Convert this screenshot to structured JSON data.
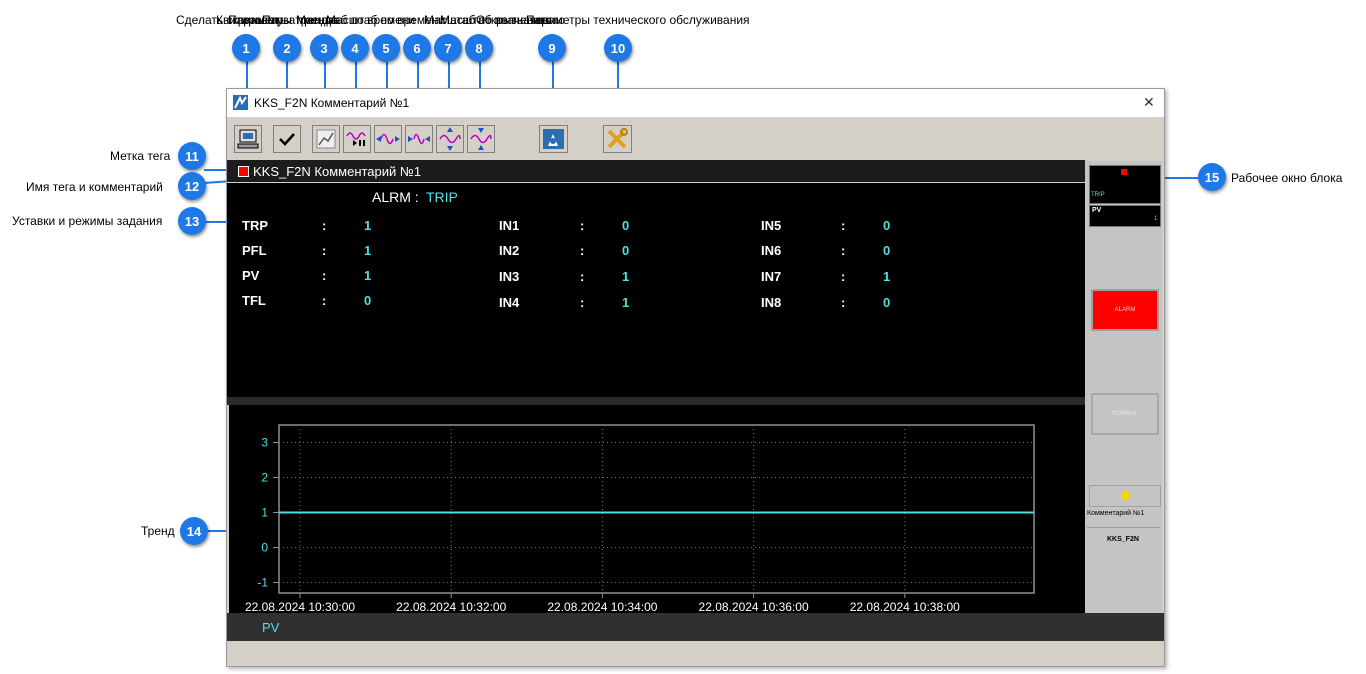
{
  "window": {
    "title": "KKS_F2N Комментарий №1",
    "close_glyph": "✕"
  },
  "toolbar_tooltips": [
    "Сделать скриншот",
    "Квитировать",
    "Параметры тренда",
    "Пауза тренда",
    "Масштаб по времени",
    "Масштаб по времени",
    "Масштаб по значению",
    "Масштаб по значению",
    "Открыть окно",
    "Параметры технического обслуживания"
  ],
  "toolbar_title_visible": "Параметры технического обслуживания",
  "tag": {
    "name": "KKS_F2N Комментарий №1",
    "marker_color": "#ff0000"
  },
  "alarm": {
    "label": "ALRM :",
    "value": "TRIP"
  },
  "params": {
    "col1": [
      {
        "k": "TRP",
        "sep": ":",
        "v": "1"
      },
      {
        "k": "PFL",
        "sep": ":",
        "v": "1"
      },
      {
        "k": "PV",
        "sep": ":",
        "v": "1"
      },
      {
        "k": "TFL",
        "sep": ":",
        "v": "0"
      }
    ],
    "col2": [
      {
        "k": "IN1",
        "sep": ":",
        "v": "0"
      },
      {
        "k": "IN2",
        "sep": ":",
        "v": "0"
      },
      {
        "k": "IN3",
        "sep": ":",
        "v": "1"
      },
      {
        "k": "IN4",
        "sep": ":",
        "v": "1"
      }
    ],
    "col3": [
      {
        "k": "IN5",
        "sep": ":",
        "v": "0"
      },
      {
        "k": "IN6",
        "sep": ":",
        "v": "0"
      },
      {
        "k": "IN7",
        "sep": ":",
        "v": "1"
      },
      {
        "k": "IN8",
        "sep": ":",
        "v": "0"
      }
    ]
  },
  "trend": {
    "y_ticks": [
      "3",
      "2",
      "1",
      "0",
      "-1"
    ],
    "x_ticks": [
      "22.08.2024 10:30:00",
      "22.08.2024 10:32:00",
      "22.08.2024 10:34:00",
      "22.08.2024 10:36:00",
      "22.08.2024 10:38:00"
    ],
    "legend": "PV",
    "line_color": "#4fe0e0"
  },
  "chart_data": {
    "type": "line",
    "x": [
      "22.08.2024 10:30:00",
      "22.08.2024 10:32:00",
      "22.08.2024 10:34:00",
      "22.08.2024 10:36:00",
      "22.08.2024 10:38:00",
      "22.08.2024 10:39:00"
    ],
    "series": [
      {
        "name": "PV",
        "values": [
          1,
          1,
          1,
          1,
          1,
          1
        ]
      }
    ],
    "ylim": [
      -1.3,
      3.5
    ],
    "yticks": [
      -1,
      0,
      1,
      2,
      3
    ],
    "grid": true,
    "legend": "bottom-left"
  },
  "block_window": {
    "trip": "TRIP",
    "pv_label": "PV",
    "pv_value": "1",
    "alarm_btn": "ALARM",
    "normal_btn": "NORMAL",
    "comment": "Комментарий №1",
    "tag": "KKS_F2N"
  },
  "callouts": {
    "labels": {
      "11": "Метка тега",
      "12": "Имя тега и комментарий",
      "13": "Уставки и режимы задания",
      "14": "Тренд",
      "15": "Рабочее окно блока"
    },
    "numbers": [
      "1",
      "2",
      "3",
      "4",
      "5",
      "6",
      "7",
      "8",
      "9",
      "10",
      "11",
      "12",
      "13",
      "14",
      "15"
    ]
  },
  "colors": {
    "callout": "#1e78e6",
    "cyan": "#4fe0e0",
    "alarm_red": "#ff0000"
  }
}
